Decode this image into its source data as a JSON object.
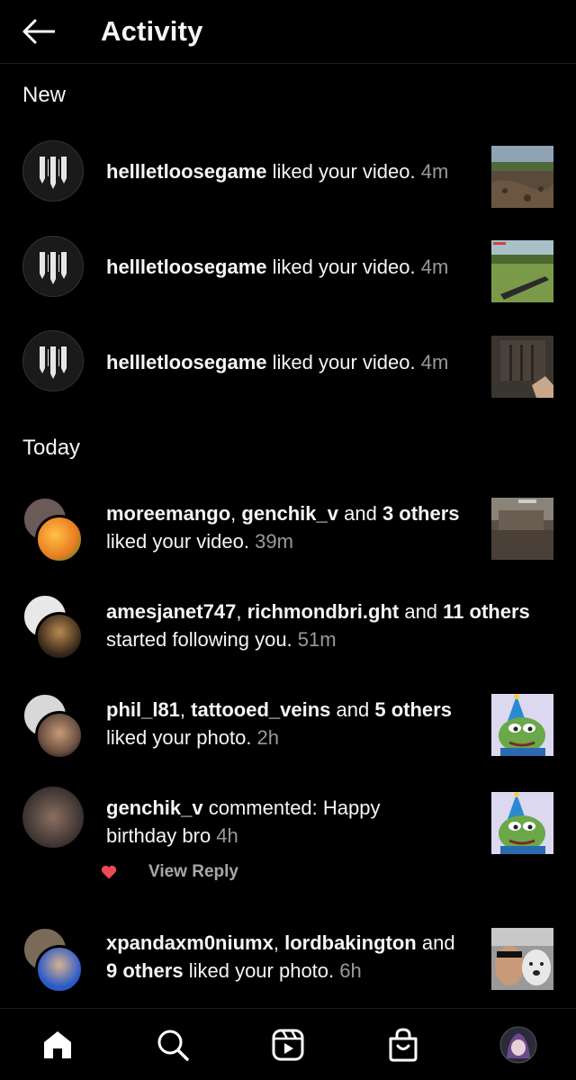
{
  "header": {
    "title": "Activity"
  },
  "sections": {
    "new": "New",
    "today": "Today"
  },
  "new_items": [
    {
      "user": "hellletloosegame",
      "action": " liked your video.",
      "time": " 4m"
    },
    {
      "user": "hellletloosegame",
      "action": " liked your video.",
      "time": " 4m"
    },
    {
      "user": "hellletloosegame",
      "action": " liked your video.",
      "time": " 4m"
    }
  ],
  "today_items": [
    {
      "user1": "moreemango",
      "sep": ", ",
      "user2": "genchik_v",
      "and": " and ",
      "others": "3 others",
      "line2": "liked your video.",
      "time": " 39m"
    },
    {
      "user1": "amesjanet747",
      "sep": ", ",
      "user2": "richmondbri.ght",
      "and": " and ",
      "others": "11 others",
      "line2": "started following you.",
      "time": " 51m"
    },
    {
      "user1": "phil_l81",
      "sep": ", ",
      "user2": "tattooed_veins",
      "and": " and ",
      "others": "5 others",
      "line2": "liked your photo.",
      "time": " 2h"
    },
    {
      "user1": "genchik_v",
      "comment_line1": " commented: Happy",
      "comment_line2": "birthday bro",
      "time": " 4h"
    },
    {
      "user1": "xpandaxm0niumx",
      "sep": ", ",
      "user2": "lordbakington",
      "and": " and",
      "others": "9 others",
      "line2": " liked your photo.",
      "time": " 6h"
    }
  ],
  "reply": {
    "label": "View Reply"
  },
  "colors": {
    "heart": "#ed4956",
    "background": "#000000",
    "muted": "#9a9a9a"
  },
  "nav": [
    "home-icon",
    "search-icon",
    "reels-icon",
    "shop-icon",
    "profile-avatar"
  ]
}
